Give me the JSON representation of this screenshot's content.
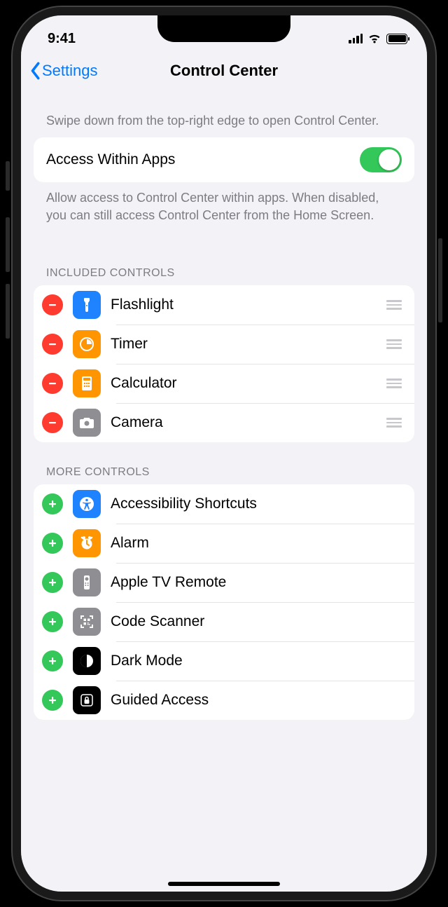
{
  "status": {
    "time": "9:41"
  },
  "nav": {
    "back": "Settings",
    "title": "Control Center"
  },
  "intro": "Swipe down from the top-right edge to open Control Center.",
  "toggle": {
    "label": "Access Within Apps",
    "footer": "Allow access to Control Center within apps. When disabled, you can still access Control Center from the Home Screen."
  },
  "sections": {
    "included": {
      "header": "INCLUDED CONTROLS",
      "items": [
        {
          "label": "Flashlight",
          "iconBg": "#1f82ff",
          "icon": "flashlight"
        },
        {
          "label": "Timer",
          "iconBg": "#ff9500",
          "icon": "timer"
        },
        {
          "label": "Calculator",
          "iconBg": "#ff9500",
          "icon": "calculator"
        },
        {
          "label": "Camera",
          "iconBg": "#8e8e93",
          "icon": "camera"
        }
      ]
    },
    "more": {
      "header": "MORE CONTROLS",
      "items": [
        {
          "label": "Accessibility Shortcuts",
          "iconBg": "#1f82ff",
          "icon": "accessibility"
        },
        {
          "label": "Alarm",
          "iconBg": "#ff9500",
          "icon": "alarm"
        },
        {
          "label": "Apple TV Remote",
          "iconBg": "#8e8e93",
          "icon": "remote"
        },
        {
          "label": "Code Scanner",
          "iconBg": "#8e8e93",
          "icon": "qr"
        },
        {
          "label": "Dark Mode",
          "iconBg": "#000000",
          "icon": "darkmode"
        },
        {
          "label": "Guided Access",
          "iconBg": "#000000",
          "icon": "lock"
        }
      ]
    }
  }
}
